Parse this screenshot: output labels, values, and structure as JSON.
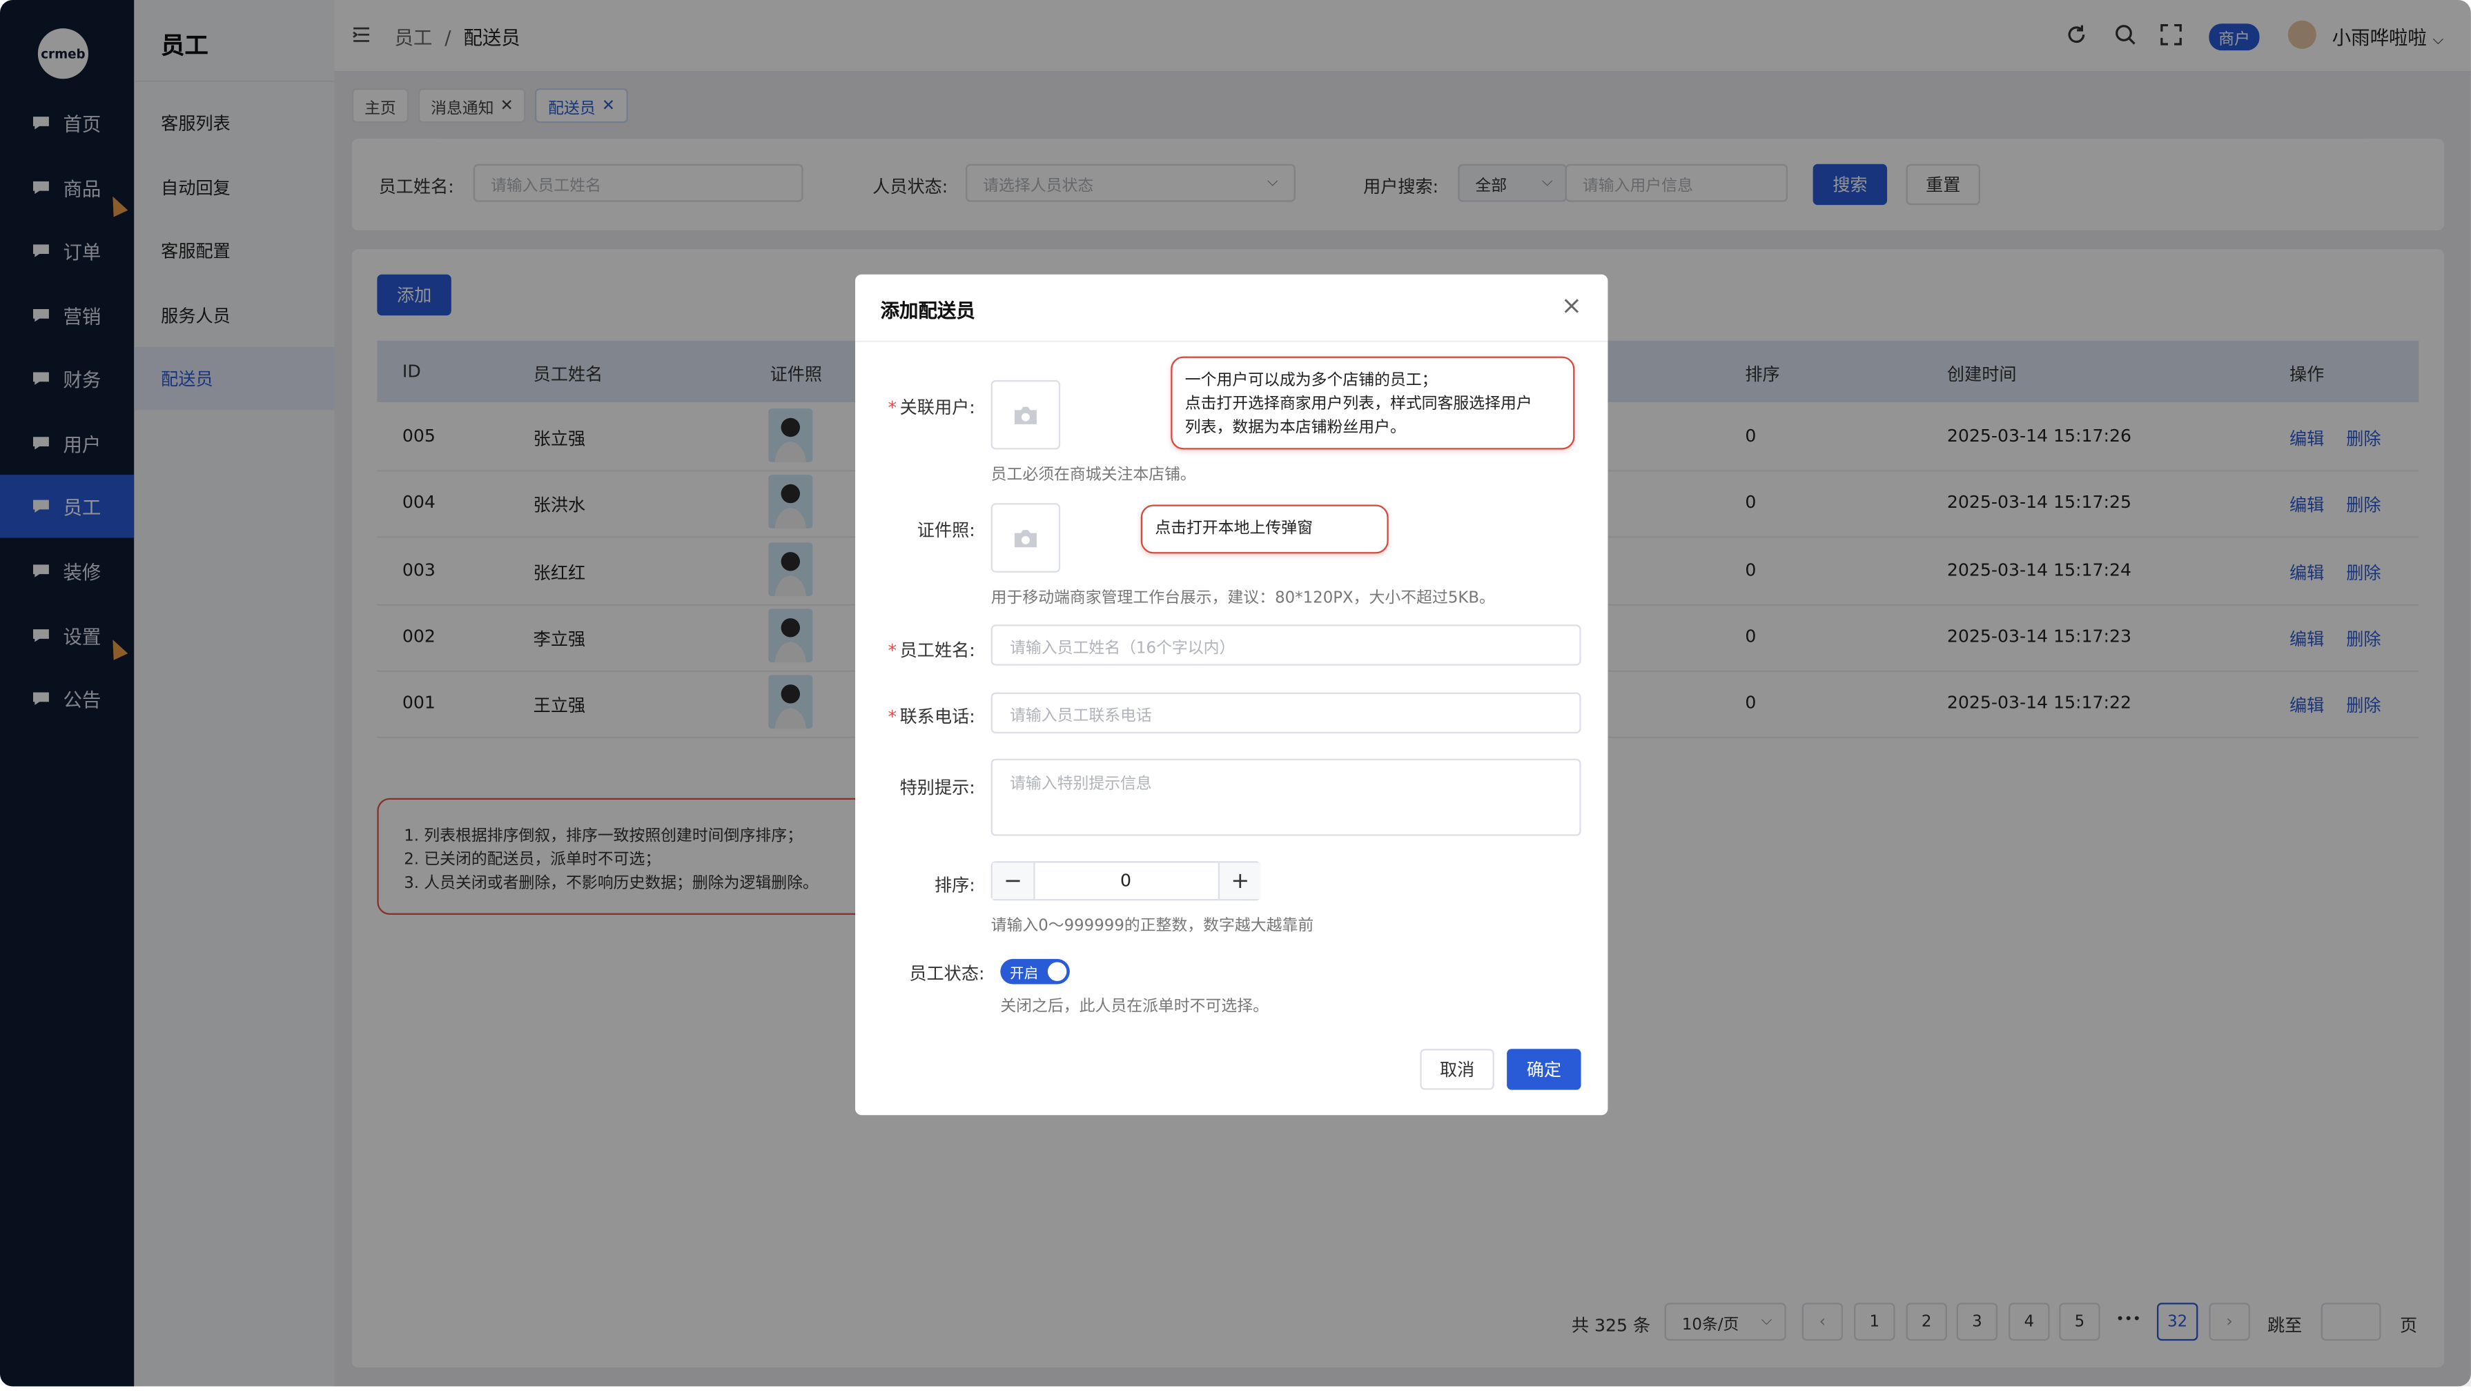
{
  "brand": {
    "logo_text": "crmeb"
  },
  "sidebar": {
    "items": [
      {
        "label": "首页"
      },
      {
        "label": "商品"
      },
      {
        "label": "订单"
      },
      {
        "label": "营销"
      },
      {
        "label": "财务"
      },
      {
        "label": "用户"
      },
      {
        "label": "员工"
      },
      {
        "label": "装修"
      },
      {
        "label": "设置"
      },
      {
        "label": "公告"
      }
    ],
    "active": "员工"
  },
  "subnav": {
    "title": "员工",
    "items": [
      {
        "label": "客服列表"
      },
      {
        "label": "自动回复"
      },
      {
        "label": "客服配置"
      },
      {
        "label": "服务人员"
      },
      {
        "label": "配送员"
      }
    ],
    "active": "配送员"
  },
  "header": {
    "breadcrumb_parent": "员工",
    "breadcrumb_sep": "/",
    "breadcrumb_current": "配送员",
    "shop_badge": "商户",
    "username": "小雨哗啦啦"
  },
  "tabs": [
    {
      "label": "主页",
      "closable": false
    },
    {
      "label": "消息通知",
      "closable": true
    },
    {
      "label": "配送员",
      "closable": true
    }
  ],
  "filters": {
    "name_label": "员工姓名:",
    "name_placeholder": "请输入员工姓名",
    "status_label": "人员状态:",
    "status_placeholder": "请选择人员状态",
    "user_label": "用户搜索:",
    "user_scope": "全部",
    "user_placeholder": "请输入用户信息",
    "search_btn": "搜索",
    "reset_btn": "重置"
  },
  "toolbar": {
    "add_btn": "添加"
  },
  "table": {
    "headers": {
      "id": "ID",
      "name": "员工姓名",
      "photo": "证件照",
      "sort": "排序",
      "created": "创建时间",
      "ops": "操作"
    },
    "rows": [
      {
        "id": "005",
        "name": "张立强",
        "sort": "0",
        "created": "2025-03-14 15:17:26"
      },
      {
        "id": "004",
        "name": "张洪水",
        "sort": "0",
        "created": "2025-03-14 15:17:25"
      },
      {
        "id": "003",
        "name": "张红红",
        "sort": "0",
        "created": "2025-03-14 15:17:24"
      },
      {
        "id": "002",
        "name": "李立强",
        "sort": "0",
        "created": "2025-03-14 15:17:23"
      },
      {
        "id": "001",
        "name": "王立强",
        "sort": "0",
        "created": "2025-03-14 15:17:22"
      }
    ],
    "edit_label": "编辑",
    "delete_label": "删除"
  },
  "notes": {
    "line1": "1. 列表根据排序倒叙，排序一致按照创建时间倒序排序；",
    "line2": "2. 已关闭的配送员，派单时不可选；",
    "line3": "3. 人员关闭或者删除，不影响历史数据；删除为逻辑删除。"
  },
  "pagination": {
    "total": "共 325 条",
    "page_size": "10条/页",
    "pages": [
      "1",
      "2",
      "3",
      "4",
      "5"
    ],
    "ellipsis": "•••",
    "last_page": "32",
    "jump_label": "跳至",
    "page_unit": "页"
  },
  "modal": {
    "title": "添加配送员",
    "user_label": "关联用户:",
    "user_hint": "员工必须在商城关注本店铺。",
    "user_callout_1": "一个用户可以成为多个店铺的员工；",
    "user_callout_2": "点击打开选择商家用户列表，样式同客服选择用户",
    "user_callout_3": "列表，数据为本店铺粉丝用户。",
    "photo_label": "证件照:",
    "photo_callout": "点击打开本地上传弹窗",
    "photo_hint": "用于移动端商家管理工作台展示，建议：80*120PX，大小不超过5KB。",
    "name_label": "员工姓名:",
    "name_placeholder": "请输入员工姓名（16个字以内）",
    "phone_label": "联系电话:",
    "phone_placeholder": "请输入员工联系电话",
    "tip_label": "特别提示:",
    "tip_placeholder": "请输入特别提示信息",
    "sort_label": "排序:",
    "sort_value": "0",
    "sort_hint": "请输入0～999999的正整数，数字越大越靠前",
    "status_label": "员工状态:",
    "status_on": "开启",
    "status_hint": "关闭之后，此人员在派单时不可选择。",
    "cancel_btn": "取消",
    "confirm_btn": "确定"
  }
}
